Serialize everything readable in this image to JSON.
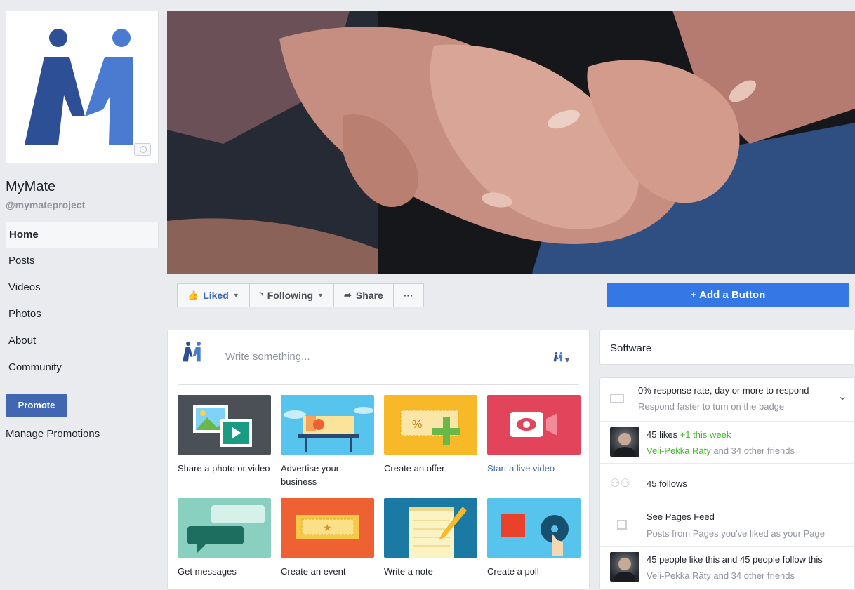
{
  "page": {
    "name": "MyMate",
    "handle": "@mymateproject"
  },
  "sidebar": {
    "items": [
      {
        "label": "Home",
        "active": true
      },
      {
        "label": "Posts"
      },
      {
        "label": "Videos"
      },
      {
        "label": "Photos"
      },
      {
        "label": "About"
      },
      {
        "label": "Community"
      }
    ],
    "promote_label": "Promote",
    "manage_label": "Manage Promotions"
  },
  "actions": {
    "liked": "Liked",
    "following": "Following",
    "share": "Share",
    "more": "···",
    "add_button": "+ Add a Button"
  },
  "composer": {
    "placeholder": "Write something...",
    "tiles": [
      {
        "label": "Share a photo or video",
        "icon": "photo-video-icon",
        "color": "#4b4f56"
      },
      {
        "label": "Advertise your business",
        "icon": "storefront-icon",
        "color": "#57c4ee"
      },
      {
        "label": "Create an offer",
        "icon": "offer-ticket-icon",
        "color": "#f7b928"
      },
      {
        "label": "Start a live video",
        "icon": "live-camera-icon",
        "color": "#e2445b",
        "link": true
      },
      {
        "label": "Get messages",
        "icon": "chat-bubbles-icon",
        "color": "#89d0c0"
      },
      {
        "label": "Create an event",
        "icon": "event-ticket-icon",
        "color": "#ee6133"
      },
      {
        "label": "Write a note",
        "icon": "notepad-icon",
        "color": "#1b7aa4"
      },
      {
        "label": "Create a poll",
        "icon": "poll-icon",
        "color": "#57c4ee"
      }
    ]
  },
  "right": {
    "software": "Software",
    "response": {
      "line1": "0% response rate, day or more to respond",
      "line2": "Respond faster to turn on the badge"
    },
    "likes": {
      "count": "45 likes",
      "delta": "+1 this week",
      "friend": "Veli-Pekka Räty",
      "others": " and 34 other friends"
    },
    "follows": "45 follows",
    "feed": {
      "line1": "See Pages Feed",
      "line2": "Posts from Pages you've liked as your Page"
    },
    "summary": {
      "line1": "45 people like this and 45 people follow this",
      "line2": "Veli-Pekka Räty and 34 other friends"
    }
  },
  "colors": {
    "accent": "#4267b2",
    "add_button": "#3578e5",
    "positive": "#42b72a",
    "logo_dark": "#2d4f96",
    "logo_light": "#4a7bd0"
  }
}
